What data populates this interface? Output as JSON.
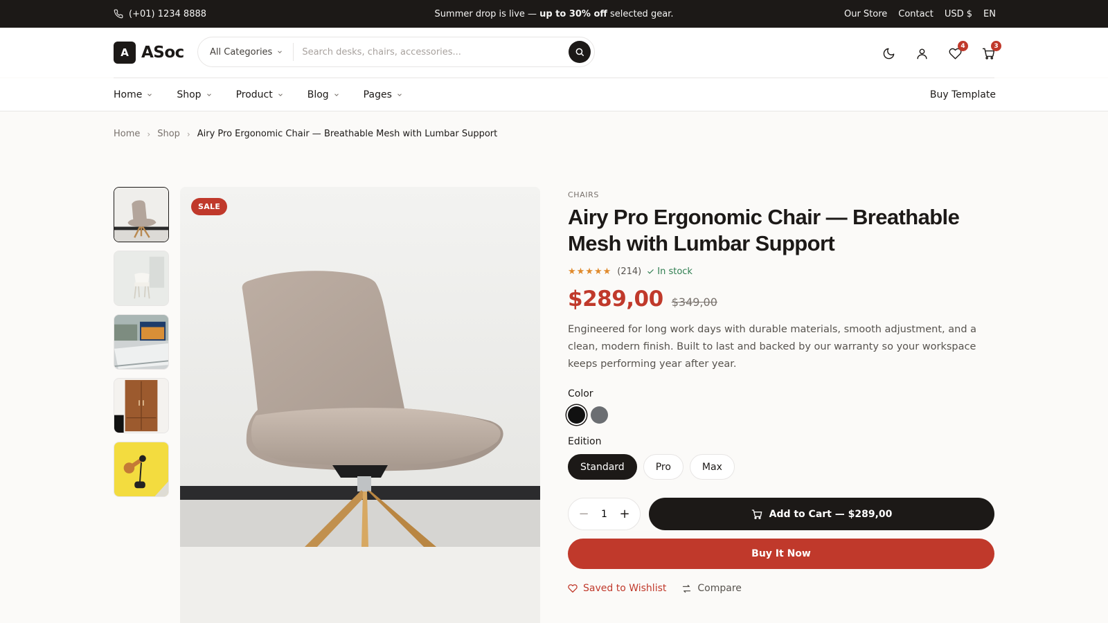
{
  "topbar": {
    "phone": "(+01) 1234 8888",
    "promo_before": "Summer drop is live —",
    "promo_bold": "up to 30% off",
    "promo_after": "selected gear.",
    "links": [
      "Our Store",
      "Contact",
      "USD $",
      "EN"
    ]
  },
  "header": {
    "logo_mark": "A",
    "logo_name": "ASoc",
    "search_category": "All Categories",
    "search_placeholder": "Search desks, chairs, accessories...",
    "wishlist_count": "4",
    "cart_count": "3",
    "icons": [
      "moon-icon",
      "user-icon",
      "heart-icon",
      "cart-icon"
    ]
  },
  "nav": {
    "items": [
      "Home",
      "Shop",
      "Product",
      "Blog",
      "Pages"
    ],
    "buy_template": "Buy Template"
  },
  "breadcrumb": [
    "Home",
    "Shop",
    "Airy Pro Ergonomic Chair — Breathable Mesh with Lumbar Support"
  ],
  "gallery": {
    "sale_badge": "SALE",
    "thumbnails": [
      "chair-thumbnail",
      "white-chair-thumbnail",
      "desk-monitor-thumbnail",
      "wood-cabinet-thumbnail",
      "yellow-lamp-thumbnail"
    ]
  },
  "product": {
    "category": "CHAIRS",
    "title": "Airy Pro Ergonomic Chair — Breathable Mesh with Lumbar Support",
    "stars": "★★★★★",
    "rating_count": "(214)",
    "stock": "In stock",
    "price": "$289,00",
    "old_price": "$349,00",
    "description": "Engineered for long work days with durable materials, smooth adjustment, and a clean, modern finish. Built to last and backed by our warranty so your workspace keeps performing year after year.",
    "color_label": "Color",
    "colors": [
      "#111111",
      "#6b6e72"
    ],
    "edition_label": "Edition",
    "editions": [
      "Standard",
      "Pro",
      "Max"
    ],
    "selected_edition": "Standard",
    "quantity": "1",
    "add_to_cart": "Add to Cart — $289,00",
    "buy_now": "Buy It Now",
    "wishlist": "Saved to Wishlist",
    "compare": "Compare"
  },
  "colors": {
    "accent": "#c0392b",
    "dark": "#1c1917",
    "success": "#2e7d4f"
  }
}
